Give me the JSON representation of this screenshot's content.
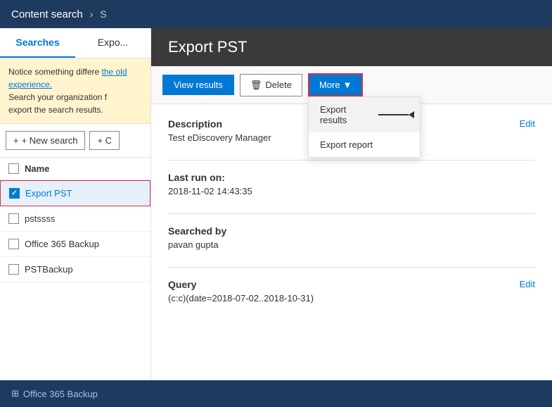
{
  "topNav": {
    "title": "Content search",
    "separator": "›",
    "subtitle": "S"
  },
  "sidebar": {
    "tabs": [
      {
        "id": "searches",
        "label": "Searches",
        "active": true
      },
      {
        "id": "exports",
        "label": "Expo...",
        "active": false
      }
    ],
    "noticeBanner": {
      "text1": "Notice something differe",
      "linkText": "the old experience.",
      "text2": "Search your organization f",
      "text3": "export the search results."
    },
    "buttons": {
      "newSearch": "+ New search",
      "other": "+ C"
    },
    "listHeader": "Name",
    "items": [
      {
        "id": "export-pst",
        "label": "Export PST",
        "checked": true,
        "selected": true
      },
      {
        "id": "pstssss",
        "label": "pstssss",
        "checked": false,
        "selected": false
      },
      {
        "id": "office365-backup",
        "label": "Office 365 Backup",
        "checked": false,
        "selected": false
      },
      {
        "id": "pstbackup",
        "label": "PSTBackup",
        "checked": false,
        "selected": false
      }
    ]
  },
  "content": {
    "header": "Export PST",
    "toolbar": {
      "viewResults": "View results",
      "delete": "Delete",
      "more": "More"
    },
    "dropdown": {
      "items": [
        {
          "id": "export-results",
          "label": "Export results",
          "highlighted": true
        },
        {
          "id": "export-report",
          "label": "Export report",
          "highlighted": false
        }
      ]
    },
    "sections": {
      "description": {
        "label": "Description",
        "value": "Test eDiscovery Manager",
        "hasEdit": true
      },
      "lastRunOn": {
        "label": "Last run on:",
        "value": "2018-11-02 14:43:35",
        "hasEdit": false
      },
      "searchedBy": {
        "label": "Searched by",
        "value": "pavan gupta",
        "hasEdit": false
      },
      "query": {
        "label": "Query",
        "value": "(c:c)(date=2018-07-02..2018-10-31)",
        "hasEdit": true,
        "editLabel": "Edit"
      }
    }
  },
  "bottomBar": {
    "linkText": "Office 365 Backup"
  },
  "labels": {
    "editLabel": "Edit",
    "deleteIcon": "🗑",
    "chevronDown": "▼",
    "checkmark": "✓",
    "plus": "+"
  }
}
